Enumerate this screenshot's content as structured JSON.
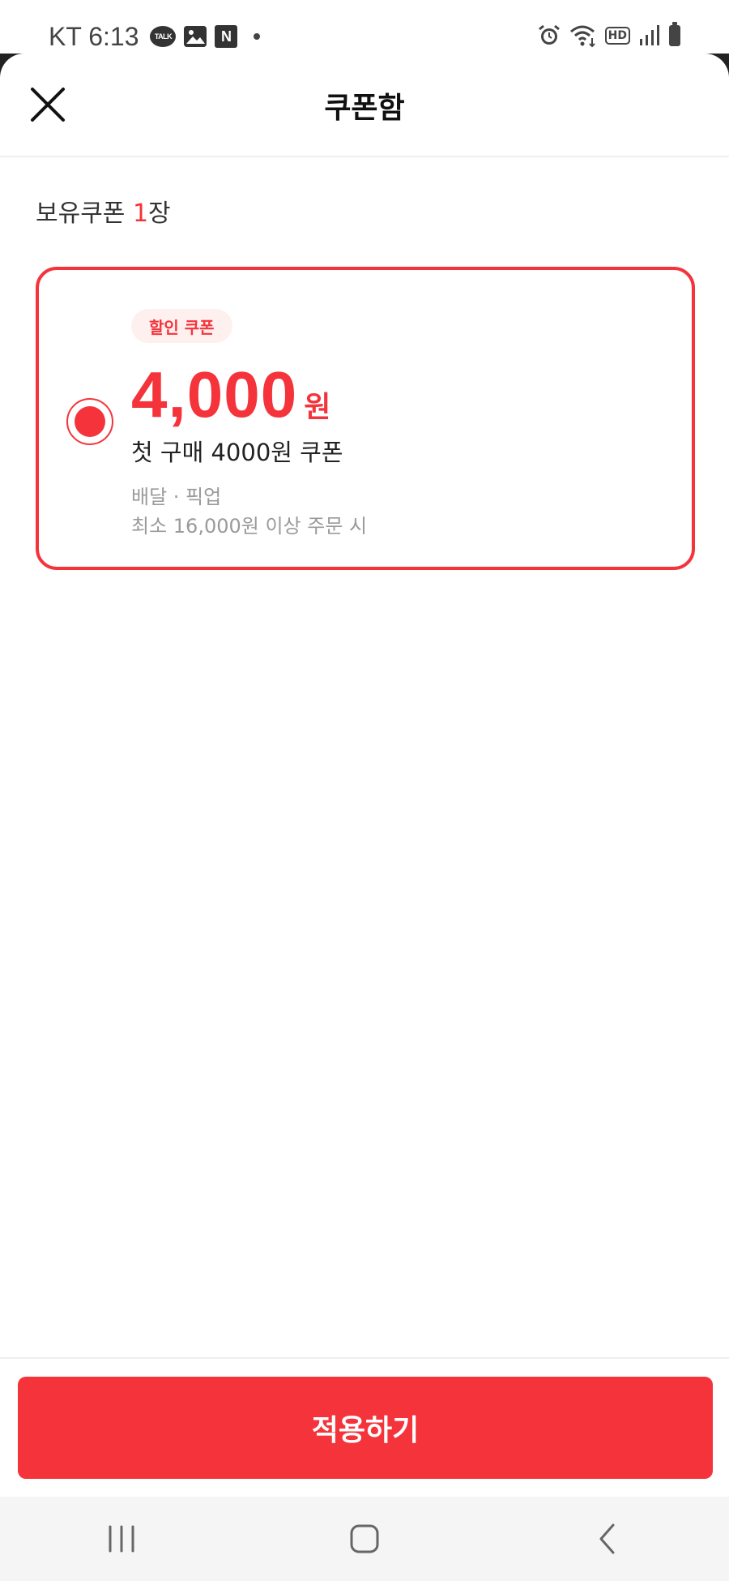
{
  "status_bar": {
    "carrier_time": "KT 6:13",
    "icons_left": [
      "kakaotalk-icon",
      "gallery-icon",
      "naver-icon",
      "dot-icon"
    ],
    "talk_text": "TALK",
    "naver_text": "N",
    "hd_text": "HD",
    "icons_right": [
      "alarm-icon",
      "wifi-icon",
      "hd-icon",
      "signal-icon",
      "battery-icon"
    ]
  },
  "header": {
    "title": "쿠폰함",
    "close_icon": "close-icon"
  },
  "coupon_count": {
    "prefix": "보유쿠폰 ",
    "count": "1",
    "suffix": "장"
  },
  "coupons": [
    {
      "selected": true,
      "badge": "할인 쿠폰",
      "amount": "4,000",
      "unit": "원",
      "name": "첫 구매 4000원 쿠폰",
      "type": "배달 · 픽업",
      "condition": "최소 16,000원 이상 주문 시"
    }
  ],
  "footer": {
    "apply_label": "적용하기"
  },
  "colors": {
    "accent": "#f5333b",
    "badge_bg": "#fff0f0",
    "muted_text": "#9a9a9a"
  },
  "nav_bar": {
    "buttons": [
      "recent-apps-icon",
      "home-icon",
      "back-icon"
    ]
  }
}
